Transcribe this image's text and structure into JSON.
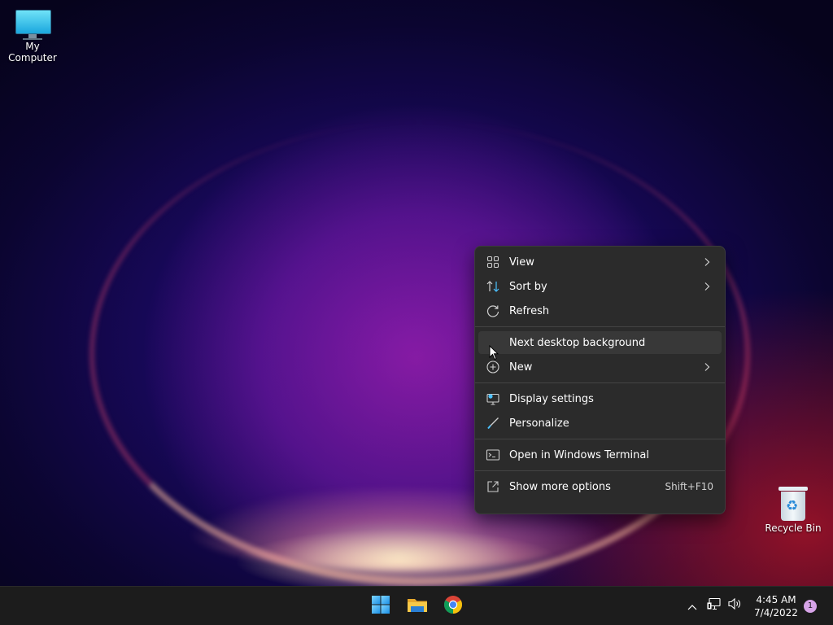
{
  "desktop": {
    "icons": [
      {
        "label": "My Computer",
        "icon": "monitor-icon"
      },
      {
        "label": "Recycle Bin",
        "icon": "recycle-bin-icon"
      }
    ]
  },
  "context_menu": {
    "groups": [
      [
        {
          "label": "View",
          "icon": "grid-icon",
          "submenu": true
        },
        {
          "label": "Sort by",
          "icon": "sort-icon",
          "submenu": true
        },
        {
          "label": "Refresh",
          "icon": "refresh-icon",
          "submenu": false
        }
      ],
      [
        {
          "label": "Next desktop background",
          "icon": "",
          "submenu": false,
          "highlighted": true
        },
        {
          "label": "New",
          "icon": "plus-circle-icon",
          "submenu": true
        }
      ],
      [
        {
          "label": "Display settings",
          "icon": "display-icon",
          "submenu": false
        },
        {
          "label": "Personalize",
          "icon": "brush-icon",
          "submenu": false
        }
      ],
      [
        {
          "label": "Open in Windows Terminal",
          "icon": "terminal-icon",
          "submenu": false
        }
      ],
      [
        {
          "label": "Show more options",
          "icon": "external-icon",
          "submenu": false,
          "shortcut": "Shift+F10"
        }
      ]
    ]
  },
  "taskbar": {
    "pinned": [
      "start-icon",
      "file-explorer-icon",
      "chrome-icon"
    ],
    "tray": [
      "chevron-up-icon",
      "network-icon",
      "volume-icon"
    ],
    "clock": {
      "time": "4:45 AM",
      "date": "7/4/2022"
    },
    "notification_count": "1"
  },
  "colors": {
    "menu_bg": "#2b2b2b",
    "menu_hover": "#383838",
    "taskbar_bg": "#1c1c1c",
    "accent_blue": "#4cc2ff"
  }
}
